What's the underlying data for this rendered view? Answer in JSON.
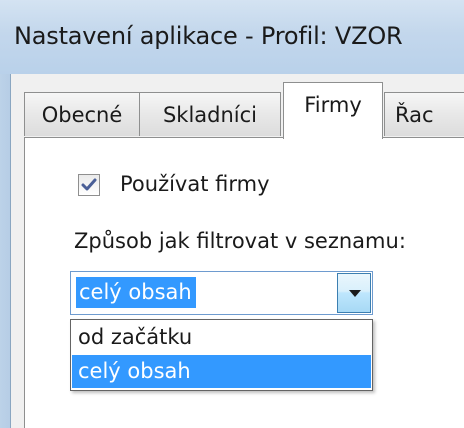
{
  "window": {
    "title": "Nastavení aplikace - Profil: VZOR"
  },
  "tabs": [
    {
      "label": "Obecné",
      "active": false
    },
    {
      "label": "Skladníci",
      "active": false
    },
    {
      "label": "Firmy",
      "active": true
    },
    {
      "label": "Řac",
      "active": false
    }
  ],
  "firmy_page": {
    "use_companies_label": "Používat firmy",
    "use_companies_checked": true,
    "filter_label": "Způsob jak filtrovat v seznamu:",
    "filter_combo": {
      "selected_value": "celý obsah",
      "options": [
        "od začátku",
        "celý obsah"
      ],
      "highlighted_index": 1
    }
  },
  "colors": {
    "selection": "#3399ff",
    "titlebar": "#c3d7ec",
    "tab_border": "#8e8f8f"
  },
  "icons": {
    "checkbox_check": "check-icon",
    "combo_arrow": "chevron-down-icon"
  }
}
